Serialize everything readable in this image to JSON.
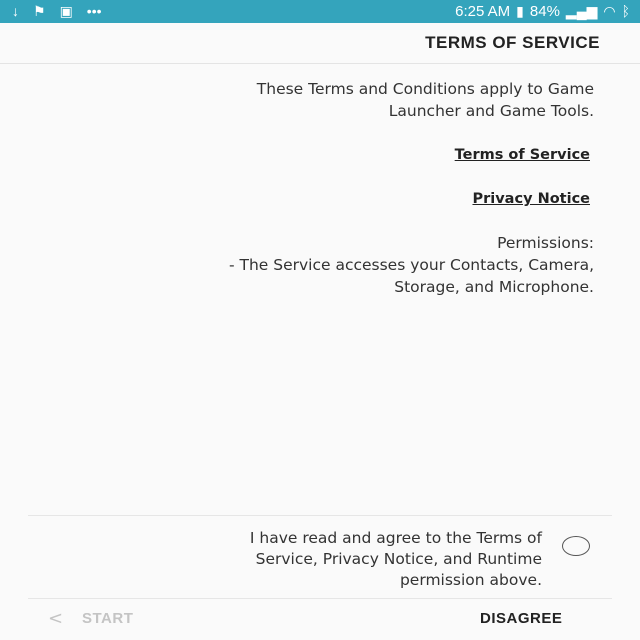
{
  "status_bar": {
    "time": "6:25 AM",
    "battery": "84%",
    "icons": [
      "download-icon",
      "flag-icon",
      "image-icon",
      "more-icon",
      "bluetooth-icon",
      "wifi-icon",
      "signal-icon",
      "battery-icon"
    ]
  },
  "header": {
    "title": "TERMS OF SERVICE"
  },
  "content": {
    "intro_line1": "These Terms and Conditions apply to Game",
    "intro_line2": "Launcher and Game Tools.",
    "terms_link": "Terms of Service",
    "privacy_link": "Privacy Notice",
    "permissions_heading": "Permissions:",
    "permissions_line1": "- The Service accesses your Contacts, Camera,",
    "permissions_line2": "Storage, and Microphone."
  },
  "agreement": {
    "line1": "I have read and agree to the Terms of",
    "line2": "Service, Privacy Notice, and Runtime",
    "line3": "permission above.",
    "checked": false
  },
  "footer": {
    "disagree_label": "DISAGREE",
    "start_label": "START",
    "start_enabled": false
  }
}
